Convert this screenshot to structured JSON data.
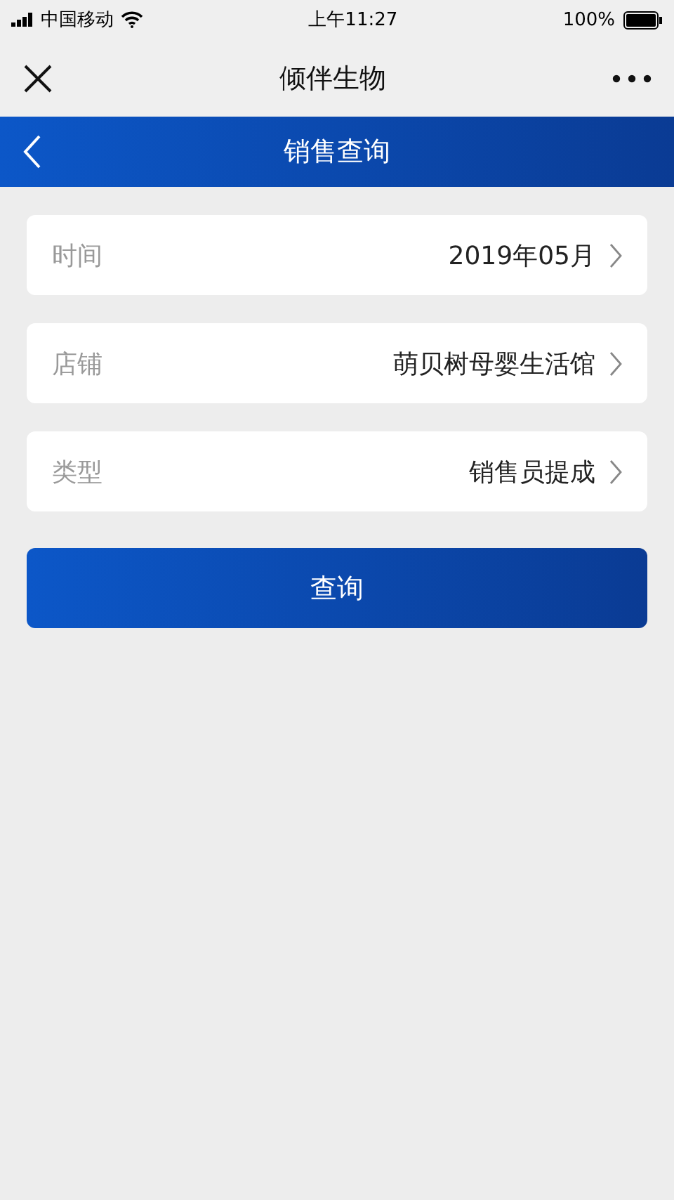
{
  "status_bar": {
    "carrier": "中国移动",
    "time": "上午11:27",
    "battery": "100%"
  },
  "nav": {
    "title": "倾伴生物"
  },
  "header": {
    "title": "销售查询"
  },
  "fields": [
    {
      "label": "时间",
      "value": "2019年05月"
    },
    {
      "label": "店铺",
      "value": "萌贝树母婴生活馆"
    },
    {
      "label": "类型",
      "value": "销售员提成"
    }
  ],
  "button": "查询"
}
